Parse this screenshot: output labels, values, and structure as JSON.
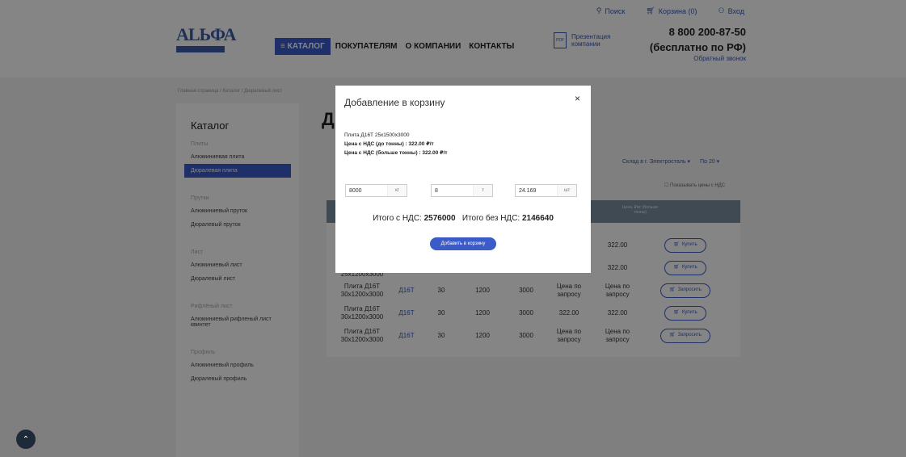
{
  "topbar": {
    "search": "Поиск",
    "cart": "Корзина (0)",
    "login": "Вход"
  },
  "header": {
    "logo_text": "ALЬФА",
    "nav": {
      "catalog": "КАТАЛОГ",
      "buyers": "ПОКУПАТЕЛЯМ",
      "company": "О КОМПАНИИ",
      "contacts": "КОНТАКТЫ"
    },
    "presentation": "Презентация компании",
    "phone": "8 800 200-87-50",
    "phone_note": "(бесплатно по РФ)",
    "callback": "Обратный звонок"
  },
  "breadcrumbs": "Главная страница / Каталог / Дюралевый лист",
  "sidebar": {
    "title": "Каталог",
    "groups": [
      {
        "name": "Плиты",
        "links": [
          "Алюминиевая плита",
          "Дюралевая плита"
        ]
      },
      {
        "name": "Прутки",
        "links": [
          "Алюминиевый пруток",
          "Дюралевый пруток"
        ]
      },
      {
        "name": "Лист",
        "links": [
          "Алюминиевый лист",
          "Дюралевый лист"
        ]
      },
      {
        "name": "Рифлёный лист",
        "links": [
          "Алюминиевый рифленый лист квинтет"
        ]
      },
      {
        "name": "Профиль",
        "links": [
          "Алюминиевый профиль",
          "Дюралевый профиль"
        ]
      }
    ],
    "active": "Дюралевая плита"
  },
  "main": {
    "title": "Д",
    "filter_warehouse": "Склад в г. Электросталь ▾",
    "filter_count": "По 20 ▾",
    "nds_check": "Показывать цены с НДС",
    "table_header_price": "Цена, ₽/кг (больше тонны)",
    "rows": [
      {
        "name": "",
        "alloy": "",
        "t": "",
        "w": "",
        "l": "",
        "p1": "",
        "p2": "322.00",
        "btn": "Купить"
      },
      {
        "name": "25x1200x3000",
        "alloy": "",
        "t": "",
        "w": "",
        "l": "",
        "p1": "",
        "p2": "322.00",
        "btn": "Купить"
      },
      {
        "name": "Плита Д16Т 30x1200x3000",
        "alloy": "Д16Т",
        "t": "30",
        "w": "1200",
        "l": "3000",
        "p1": "Цена по запросу",
        "p2": "Цена по запросу",
        "btn": "Запросить"
      },
      {
        "name": "Плита Д16Т 30x1200x3000",
        "alloy": "Д16Т",
        "t": "30",
        "w": "1200",
        "l": "3000",
        "p1": "322.00",
        "p2": "322.00",
        "btn": "Купить"
      },
      {
        "name": "Плита Д16Т 30x1200x3000",
        "alloy": "Д16Т",
        "t": "30",
        "w": "1200",
        "l": "3000",
        "p1": "Цена по запросу",
        "p2": "Цена по запросу",
        "btn": "Запросить"
      }
    ]
  },
  "modal": {
    "title": "Добавление в корзину",
    "close": "×",
    "product": "Плита Д16Т 25x1500x3000",
    "price_small": "Цена с НДС (до тонны) : 322.00 ₽/т",
    "price_big": "Цена с НДС (больше тонны) : 322.00 ₽/т",
    "qty_kg": "8000",
    "unit_kg": "кг",
    "qty_t": "8",
    "unit_t": "т",
    "qty_pcs": "24.169",
    "unit_pcs": "шт",
    "total_nds_label": "Итого с НДС:",
    "total_nds": "2576000",
    "total_no_nds_label": "Итого без НДС:",
    "total_no_nds": "2146640",
    "add_button": "Добавить в корзину"
  },
  "scrolltop": "⌃"
}
